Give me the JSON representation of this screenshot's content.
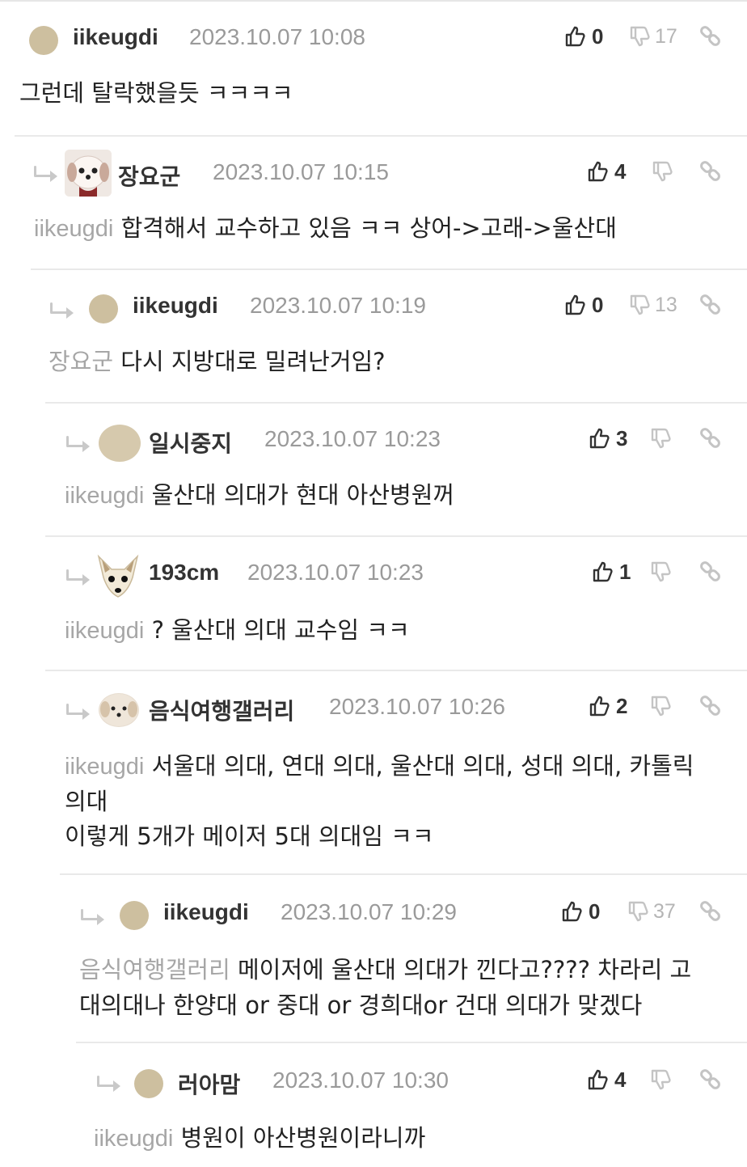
{
  "comments": [
    {
      "author": "iikeugdi",
      "date": "2023.10.07 10:08",
      "up": "0",
      "down": "17",
      "mention": "",
      "text": "그런데 탈락했을듯 ㅋㅋㅋㅋ",
      "avatar": "dot-avatar"
    },
    {
      "author": "장요군",
      "date": "2023.10.07 10:15",
      "up": "4",
      "down": "",
      "mention": "iikeugdi",
      "text": "합격해서 교수하고 있음 ㅋㅋ 상어->고래->울산대",
      "avatar": "dog-photo-avatar"
    },
    {
      "author": "iikeugdi",
      "date": "2023.10.07 10:19",
      "up": "0",
      "down": "13",
      "mention": "장요군",
      "text": "다시 지방대로 밀려난거임?",
      "avatar": "dot-avatar"
    },
    {
      "author": "일시중지",
      "date": "2023.10.07 10:23",
      "up": "3",
      "down": "",
      "mention": "iikeugdi",
      "text": "울산대 의대가 현대 아산병원꺼",
      "avatar": "oval-avatar"
    },
    {
      "author": "193cm",
      "date": "2023.10.07 10:23",
      "up": "1",
      "down": "",
      "mention": "iikeugdi",
      "text": "? 울산대 의대 교수임 ㅋㅋ",
      "avatar": "fox-avatar"
    },
    {
      "author": "음식여행갤러리",
      "date": "2023.10.07 10:26",
      "up": "2",
      "down": "",
      "mention": "iikeugdi",
      "text": "서울대 의대, 연대 의대, 울산대 의대, 성대 의대, 카톨릭",
      "text2": "의대",
      "text3": "이렇게 5개가 메이저 5대 의대임 ㅋㅋ",
      "avatar": "puppy-avatar"
    },
    {
      "author": "iikeugdi",
      "date": "2023.10.07 10:29",
      "up": "0",
      "down": "37",
      "mention": "음식여행갤러리",
      "text": "메이저에 울산대 의대가 낀다고???? 차라리 고",
      "text2": "대의대나 한양대 or 중대 or 경희대or 건대 의대가 맞겠다",
      "avatar": "dot-avatar"
    },
    {
      "author": "러아맘",
      "date": "2023.10.07 10:30",
      "up": "4",
      "down": "",
      "mention": "iikeugdi",
      "text": "병원이 아산병원이라니까",
      "avatar": "dot-avatar"
    }
  ],
  "icons": {
    "like": "thumbs-up-icon",
    "dislike": "thumbs-down-icon",
    "link": "link-icon",
    "reply": "reply-arrow-icon"
  },
  "colors": {
    "muted": "#9a9a9a",
    "mention": "#a6a6a6",
    "divider": "#e9e9e9",
    "avatar": "#cdbf9f"
  }
}
